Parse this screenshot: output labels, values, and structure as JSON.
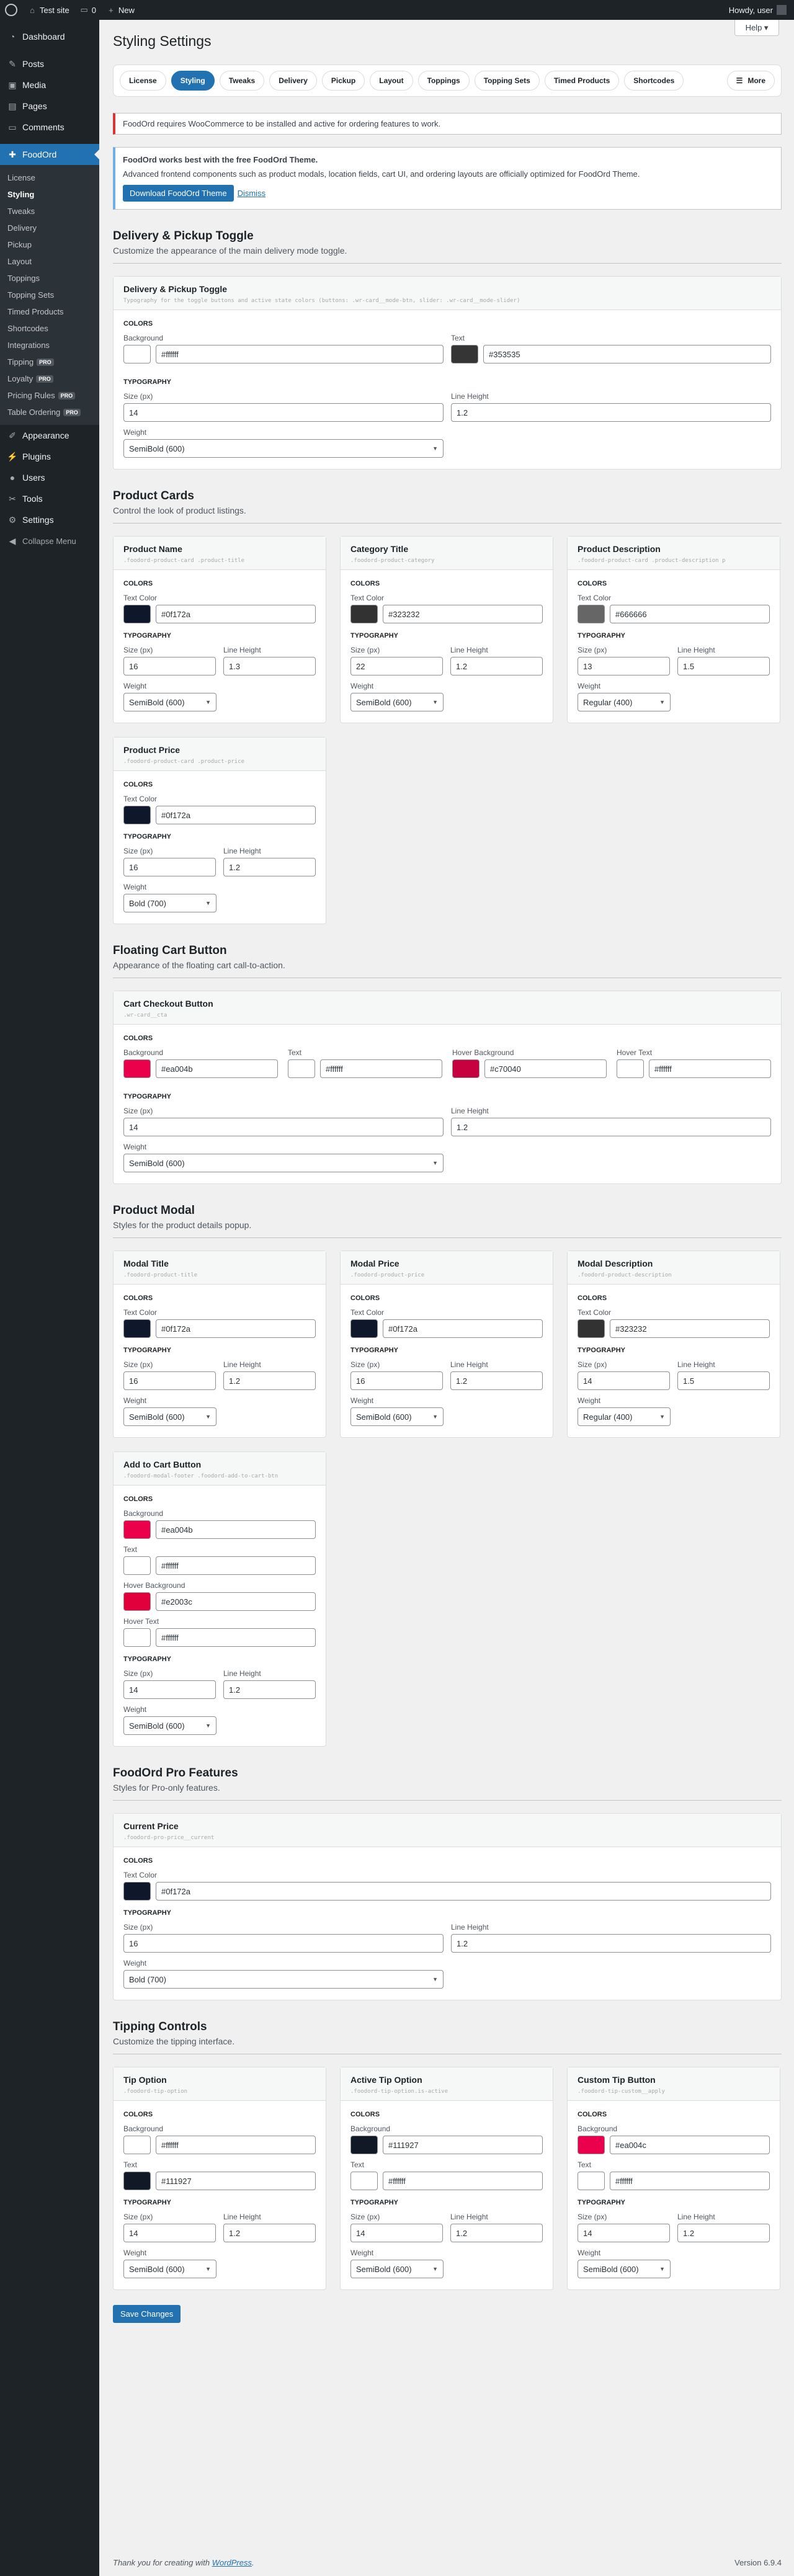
{
  "adminbar": {
    "site": "Test site",
    "comments": "0",
    "new": "New",
    "howdy": "Howdy, user"
  },
  "help": "Help ▾",
  "menu": {
    "dashboard": "Dashboard",
    "posts": "Posts",
    "media": "Media",
    "pages": "Pages",
    "comments": "Comments",
    "foodord": "FoodOrd",
    "sub": [
      "License",
      "Styling",
      "Tweaks",
      "Delivery",
      "Pickup",
      "Layout",
      "Toppings",
      "Topping Sets",
      "Timed Products",
      "Shortcodes",
      "Integrations",
      "Tipping",
      "Loyalty",
      "Pricing Rules",
      "Table Ordering"
    ],
    "pro_badge": "PRO",
    "appearance": "Appearance",
    "plugins": "Plugins",
    "users": "Users",
    "tools": "Tools",
    "settings": "Settings",
    "collapse": "Collapse Menu"
  },
  "page_title": "Styling Settings",
  "tabs": [
    "License",
    "Styling",
    "Tweaks",
    "Delivery",
    "Pickup",
    "Layout",
    "Toppings",
    "Topping Sets",
    "Timed Products",
    "Shortcodes",
    "More"
  ],
  "notice_error": "FoodOrd requires WooCommerce to be installed and active for ordering features to work.",
  "notice_info": {
    "title": "FoodOrd works best with the free FoodOrd Theme.",
    "body": "Advanced frontend components such as product modals, location fields, cart UI, and ordering layouts are officially optimized for FoodOrd Theme.",
    "button": "Download FoodOrd Theme",
    "dismiss": "Dismiss"
  },
  "labels": {
    "colors": "COLORS",
    "typography": "TYPOGRAPHY",
    "background": "Background",
    "text": "Text",
    "text_color": "Text Color",
    "hover_bg": "Hover Background",
    "hover_text": "Hover Text",
    "size": "Size (px)",
    "line_height": "Line Height",
    "weight": "Weight"
  },
  "sections": {
    "toggle": {
      "title": "Delivery & Pickup Toggle",
      "desc": "Customize the appearance of the main delivery mode toggle.",
      "card": {
        "title": "Delivery & Pickup Toggle",
        "sel": "Typography for the toggle buttons and active state colors (buttons: .wr-card__mode-btn, slider: .wr-card__mode-slider)",
        "bg": "#ffffff",
        "bg_hex": "#ffffff",
        "text": "#353535",
        "text_hex": "#353535",
        "size": "14",
        "lh": "1.2",
        "weight": "SemiBold (600)"
      }
    },
    "product_cards": {
      "title": "Product Cards",
      "desc": "Control the look of product listings.",
      "cards": [
        {
          "title": "Product Name",
          "sel": ".foodord-product-card .product-title",
          "color": "#0f172a",
          "hex": "#0f172a",
          "size": "16",
          "lh": "1.3",
          "weight": "SemiBold (600)"
        },
        {
          "title": "Category Title",
          "sel": ".foodord-product-category",
          "color": "#323232",
          "hex": "#323232",
          "size": "22",
          "lh": "1.2",
          "weight": "SemiBold (600)"
        },
        {
          "title": "Product Description",
          "sel": ".foodord-product-card .product-description p",
          "color": "#666666",
          "hex": "#666666",
          "size": "13",
          "lh": "1.5",
          "weight": "Regular (400)"
        },
        {
          "title": "Product Price",
          "sel": ".foodord-product-card .product-price",
          "color": "#0f172a",
          "hex": "#0f172a",
          "size": "16",
          "lh": "1.2",
          "weight": "Bold (700)"
        }
      ]
    },
    "floating": {
      "title": "Floating Cart Button",
      "desc": "Appearance of the floating cart call-to-action.",
      "card": {
        "title": "Cart Checkout Button",
        "sel": ".wr-card__cta",
        "bg": "#ea004b",
        "bg_hex": "#ea004b",
        "text": "#ffffff",
        "text_hex": "#ffffff",
        "hbg": "#c70040",
        "hbg_hex": "#c70040",
        "htext": "#ffffff",
        "htext_hex": "#ffffff",
        "size": "14",
        "lh": "1.2",
        "weight": "SemiBold (600)"
      }
    },
    "modal": {
      "title": "Product Modal",
      "desc": "Styles for the product details popup.",
      "cards": [
        {
          "title": "Modal Title",
          "sel": ".foodord-product-title",
          "color": "#0f172a",
          "hex": "#0f172a",
          "size": "16",
          "lh": "1.2",
          "weight": "SemiBold (600)"
        },
        {
          "title": "Modal Price",
          "sel": ".foodord-product-price",
          "color": "#0f172a",
          "hex": "#0f172a",
          "size": "16",
          "lh": "1.2",
          "weight": "SemiBold (600)"
        },
        {
          "title": "Modal Description",
          "sel": ".foodord-product-description",
          "color": "#323232",
          "hex": "#323232",
          "size": "14",
          "lh": "1.5",
          "weight": "Regular (400)"
        }
      ],
      "addcart": {
        "title": "Add to Cart Button",
        "sel": ".foodord-modal-footer .foodord-add-to-cart-btn",
        "bg": "#ea004b",
        "bg_hex": "#ea004b",
        "text": "#ffffff",
        "text_hex": "#ffffff",
        "hbg": "#e2003c",
        "hbg_hex": "#e2003c",
        "htext": "#ffffff",
        "htext_hex": "#ffffff",
        "size": "14",
        "lh": "1.2",
        "weight": "SemiBold (600)"
      }
    },
    "pro": {
      "title": "FoodOrd Pro Features",
      "desc": "Styles for Pro-only features.",
      "card": {
        "title": "Current Price",
        "sel": ".foodord-pro-price__current",
        "color": "#0f172a",
        "hex": "#0f172a",
        "size": "16",
        "lh": "1.2",
        "weight": "Bold (700)"
      }
    },
    "tipping": {
      "title": "Tipping Controls",
      "desc": "Customize the tipping interface.",
      "cards": [
        {
          "title": "Tip Option",
          "sel": ".foodord-tip-option",
          "bg": "#ffffff",
          "bg_hex": "#ffffff",
          "text": "#111927",
          "text_hex": "#111927",
          "size": "14",
          "lh": "1.2",
          "weight": "SemiBold (600)"
        },
        {
          "title": "Active Tip Option",
          "sel": ".foodord-tip-option.is-active",
          "bg": "#111927",
          "bg_hex": "#111927",
          "text": "#ffffff",
          "text_hex": "#ffffff",
          "size": "14",
          "lh": "1.2",
          "weight": "SemiBold (600)"
        },
        {
          "title": "Custom Tip Button",
          "sel": ".foodord-tip-custom__apply",
          "bg": "#ea004c",
          "bg_hex": "#ea004c",
          "text": "#ffffff",
          "text_hex": "#ffffff",
          "size": "14",
          "lh": "1.2",
          "weight": "SemiBold (600)"
        }
      ]
    }
  },
  "save": "Save Changes",
  "footer": {
    "thanks": "Thank you for creating with",
    "wp": "WordPress",
    "version": "Version 6.9.4"
  }
}
